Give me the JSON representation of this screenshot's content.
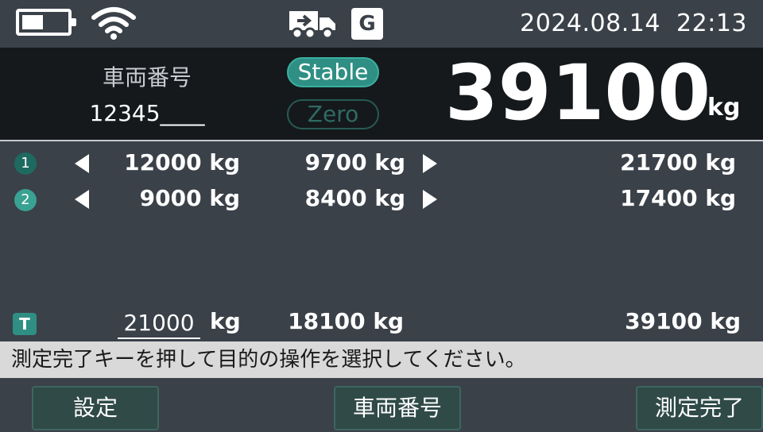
{
  "status_bar": {
    "icons": [
      "battery-icon",
      "wifi-icon",
      "truck-icon"
    ],
    "g_badge": "G",
    "date": "2024.08.14",
    "time": "22:13"
  },
  "weight_panel": {
    "vehicle_label": "車両番号",
    "vehicle_number": "12345____",
    "stable": "Stable",
    "zero": "Zero",
    "weight": "39100",
    "unit": "kg"
  },
  "rows": [
    {
      "badge": "1",
      "first": "12000 kg",
      "second": "9700 kg",
      "net": "21700 kg"
    },
    {
      "badge": "2",
      "first": "9000 kg",
      "second": "8400 kg",
      "net": "17400 kg"
    }
  ],
  "total": {
    "badge": "T",
    "first": "21000",
    "first_unit": "kg",
    "second": "18100 kg",
    "net": "39100 kg"
  },
  "message": "測定完了キーを押して目的の操作を選択してください。",
  "buttons": {
    "settings": "設定",
    "vehicle": "車両番号",
    "complete": "測定完了"
  },
  "colors": {
    "background": "#3a4149",
    "panel": "#15191c",
    "accent": "#2f8f84",
    "message_bar": "#d9d9d9"
  }
}
